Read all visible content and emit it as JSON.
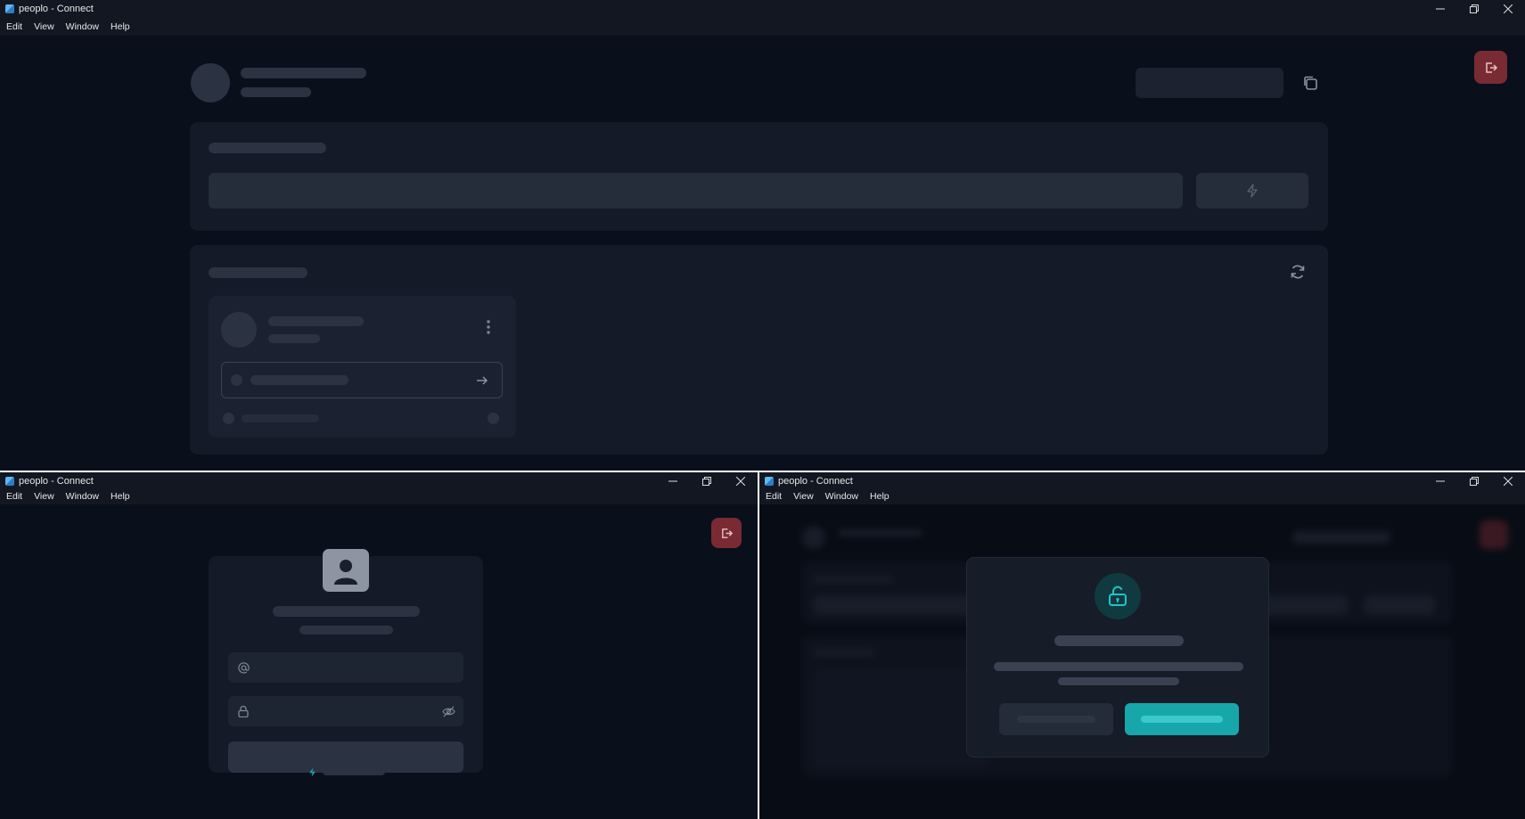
{
  "window": {
    "title": "peoplo - Connect",
    "menu": [
      "Edit",
      "View",
      "Window",
      "Help"
    ]
  },
  "colors": {
    "background": "#0a0f1c",
    "card": "#141a27",
    "skeleton": "#2b3342",
    "logout": "#7a2a33",
    "accent": "#17a7ab"
  },
  "icons": {
    "logout": "logout-icon",
    "copy": "copy-icon",
    "connect": "bolt-icon",
    "refresh": "refresh-icon",
    "menu": "more-vertical-icon",
    "arrow": "arrow-right-icon",
    "email": "at-sign-icon",
    "password": "lock-icon",
    "visibility": "eye-off-icon",
    "avatar": "user-icon",
    "unlock": "unlock-icon"
  }
}
